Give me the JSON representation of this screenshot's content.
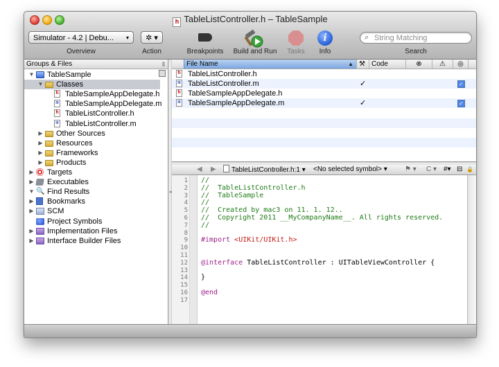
{
  "window": {
    "title": "TableListController.h – TableSample",
    "title_file_icon_letter": "h"
  },
  "toolbar": {
    "overview_popup": "Simulator - 4.2 | Debu...",
    "overview_arrow": "▾",
    "overview_label": "Overview",
    "action_popup": "✲ ▾",
    "action_label": "Action",
    "breakpoints_label": "Breakpoints",
    "build_label": "Build and Run",
    "tasks_label": "Tasks",
    "info_label": "Info",
    "info_glyph": "i",
    "search_placeholder": "String Matching",
    "search_label": "Search"
  },
  "sidebar": {
    "header": "Groups & Files",
    "header_icon": "⦀",
    "items": [
      {
        "label": "TableSample",
        "icon": "project-icon",
        "disclosure": "▼"
      },
      {
        "label": "Classes",
        "icon": "folder-icon",
        "disclosure": "▼"
      },
      {
        "label": "TableSampleAppDelegate.h",
        "icon": "header-file-icon",
        "glyph": "h"
      },
      {
        "label": "TableSampleAppDelegate.m",
        "icon": "implementation-file-icon",
        "glyph": "m"
      },
      {
        "label": "TableListController.h",
        "icon": "header-file-icon",
        "glyph": "h"
      },
      {
        "label": "TableListController.m",
        "icon": "implementation-file-icon",
        "glyph": "m"
      },
      {
        "label": "Other Sources",
        "icon": "folder-icon",
        "disclosure": "▶"
      },
      {
        "label": "Resources",
        "icon": "folder-icon",
        "disclosure": "▶"
      },
      {
        "label": "Frameworks",
        "icon": "folder-icon",
        "disclosure": "▶"
      },
      {
        "label": "Products",
        "icon": "folder-icon",
        "disclosure": "▶"
      },
      {
        "label": "Targets",
        "icon": "target-icon",
        "disclosure": "▶"
      },
      {
        "label": "Executables",
        "icon": "executable-icon",
        "disclosure": "▶"
      },
      {
        "label": "Find Results",
        "icon": "find-icon",
        "disclosure": "▼"
      },
      {
        "label": "Bookmarks",
        "icon": "bookmark-icon",
        "disclosure": "▶"
      },
      {
        "label": "SCM",
        "icon": "scm-icon",
        "disclosure": "▶"
      },
      {
        "label": "Project Symbols",
        "icon": "symbols-icon"
      },
      {
        "label": "Implementation Files",
        "icon": "smart-group-icon",
        "disclosure": "▶"
      },
      {
        "label": "Interface Builder Files",
        "icon": "smart-group-icon",
        "disclosure": "▶"
      }
    ]
  },
  "filelist": {
    "columns": {
      "file_name": "File Name",
      "sort_indicator": "▲",
      "build": "⚒",
      "code": "Code",
      "errors": "⊗",
      "warnings": "⚠",
      "target": "◎"
    },
    "rows": [
      {
        "name": "TableListController.h",
        "glyph": "h",
        "checked_build": false,
        "in_target": false
      },
      {
        "name": "TableListController.m",
        "glyph": "m",
        "checked_build": true,
        "in_target": true
      },
      {
        "name": "TableSampleAppDelegate.h",
        "glyph": "h",
        "checked_build": false,
        "in_target": false
      },
      {
        "name": "TableSampleAppDelegate.m",
        "glyph": "m",
        "checked_build": true,
        "in_target": true
      }
    ],
    "check_glyph": "✓"
  },
  "editor": {
    "nav": {
      "back": "◀",
      "forward": "▶",
      "file": "TableListController.h:1 ▾",
      "symbol": "<No selected symbol> ▾",
      "bookmarks": "⚑ ▾",
      "counterparts": "C ▾",
      "includes": "#▾",
      "split": "⊟",
      "lock": "🔒"
    },
    "lines": [
      {
        "n": "1",
        "segments": [
          {
            "t": "//",
            "c": "comment"
          }
        ]
      },
      {
        "n": "2",
        "segments": [
          {
            "t": "//  TableListController.h",
            "c": "comment"
          }
        ]
      },
      {
        "n": "3",
        "segments": [
          {
            "t": "//  TableSample",
            "c": "comment"
          }
        ]
      },
      {
        "n": "4",
        "segments": [
          {
            "t": "//",
            "c": "comment"
          }
        ]
      },
      {
        "n": "5",
        "segments": [
          {
            "t": "//  Created by mac3 on 11. 1. 12..",
            "c": "comment"
          }
        ]
      },
      {
        "n": "6",
        "segments": [
          {
            "t": "//  Copyright 2011 __MyCompanyName__. All rights reserved.",
            "c": "comment"
          }
        ]
      },
      {
        "n": "7",
        "segments": [
          {
            "t": "//",
            "c": "comment"
          }
        ]
      },
      {
        "n": "8",
        "segments": []
      },
      {
        "n": "9",
        "segments": [
          {
            "t": "#import ",
            "c": "kw"
          },
          {
            "t": "<UIKit/UIKit.h>",
            "c": "str"
          }
        ]
      },
      {
        "n": "10",
        "segments": []
      },
      {
        "n": "11",
        "segments": []
      },
      {
        "n": "12",
        "segments": [
          {
            "t": "@interface",
            "c": "kw"
          },
          {
            "t": " TableListController : UITableViewController {",
            "c": "plain"
          }
        ]
      },
      {
        "n": "13",
        "segments": []
      },
      {
        "n": "14",
        "segments": [
          {
            "t": "}",
            "c": "plain"
          }
        ]
      },
      {
        "n": "15",
        "segments": []
      },
      {
        "n": "16",
        "segments": [
          {
            "t": "@end",
            "c": "kw"
          }
        ]
      },
      {
        "n": "17",
        "segments": []
      }
    ]
  }
}
